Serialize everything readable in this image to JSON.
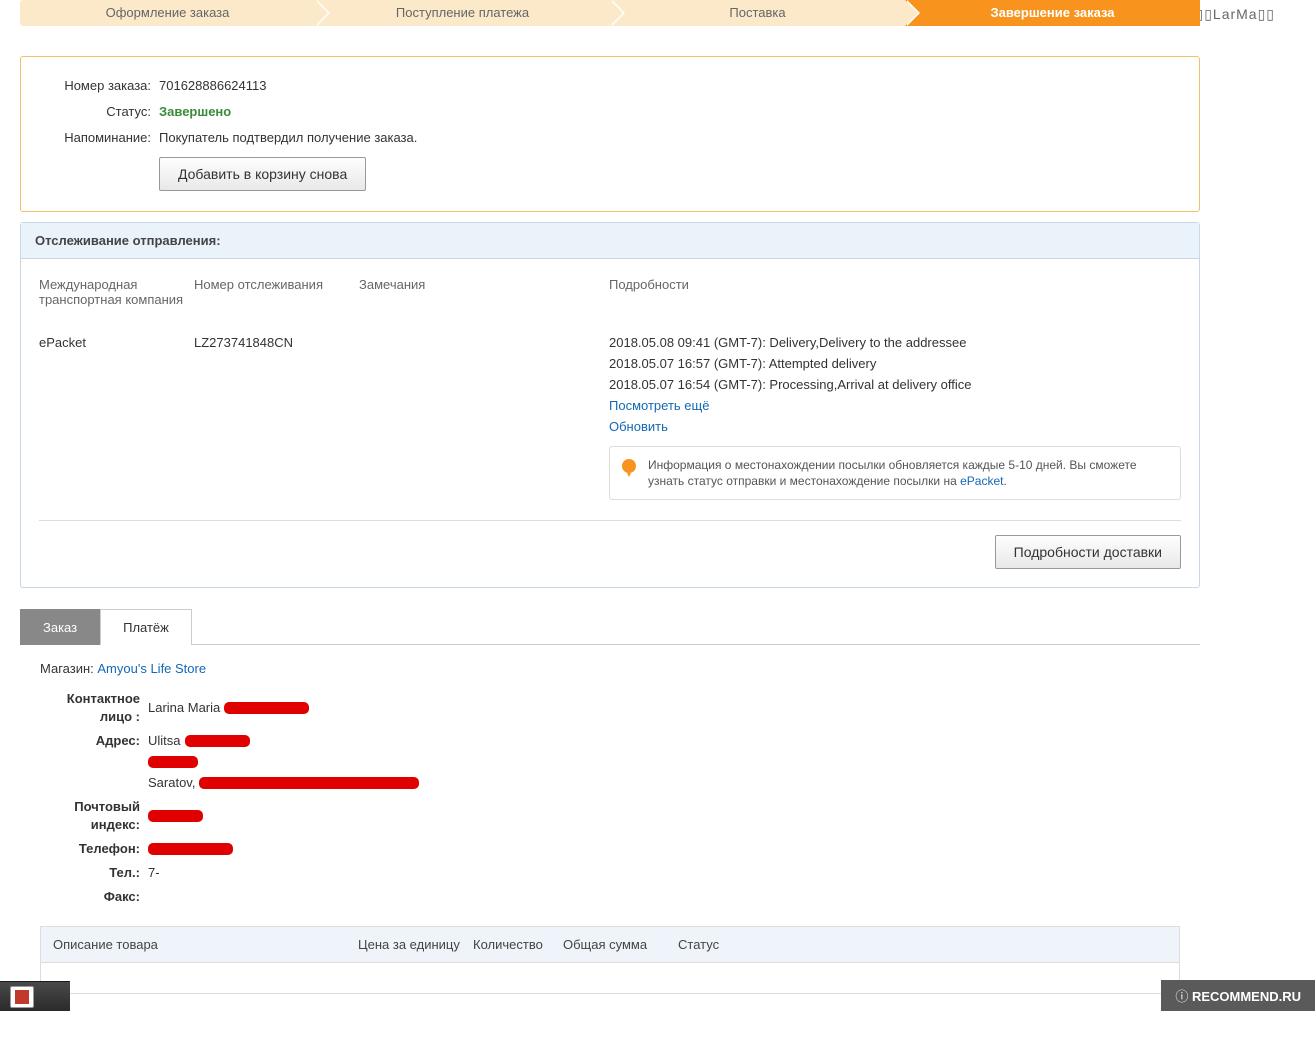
{
  "watermark_top": "▯▯LarMa▯▯",
  "watermark_bottom": "RECOMMEND.RU",
  "steps": [
    {
      "label": "Оформление заказа",
      "active": false
    },
    {
      "label": "Поступление платежа",
      "active": false
    },
    {
      "label": "Поставка",
      "active": false
    },
    {
      "label": "Завершение заказа",
      "active": true
    }
  ],
  "order": {
    "labels": {
      "number": "Номер заказа:",
      "status": "Статус:",
      "reminder": "Напоминание:"
    },
    "number": "701628886624113",
    "status": "Завершено",
    "reminder": "Покупатель подтвердил получение заказа.",
    "add_to_cart_btn": "Добавить в корзину снова"
  },
  "tracking": {
    "header": "Отслеживание отправления:",
    "columns": {
      "carrier": "Международная транспортная компания",
      "number": "Номер отслеживания",
      "remarks": "Замечания",
      "details": "Подробности"
    },
    "carrier": "ePacket",
    "tracking_number": "LZ273741848CN",
    "events": [
      "2018.05.08 09:41 (GMT-7): Delivery,Delivery to the addressee",
      "2018.05.07 16:57 (GMT-7): Attempted delivery",
      "2018.05.07 16:54 (GMT-7): Processing,Arrival at delivery office"
    ],
    "see_more": "Посмотреть ещё",
    "refresh": "Обновить",
    "tip_text": "Информация о местонахождении посылки обновляется каждые 5-10 дней. Вы сможете узнать статус отправки и местонахождение посылки на ",
    "tip_link": "ePacket",
    "details_btn": "Подробности доставки"
  },
  "tabs": [
    {
      "label": "Заказ",
      "active": true
    },
    {
      "label": "Платёж",
      "active": false
    }
  ],
  "store": {
    "label": "Магазин:",
    "name": "Amyou's Life Store"
  },
  "contact": {
    "labels": {
      "person": "Контактное лицо :",
      "address": "Адрес:",
      "postal": "Почтовый индекс:",
      "phone": "Телефон:",
      "tel": "Тел.:",
      "fax": "Факс:"
    },
    "person_prefix": "Larina Maria",
    "address_prefix": "Ulitsa",
    "city_prefix": "Saratov,",
    "tel_value": "7-"
  },
  "product_table": {
    "headers": {
      "desc": "Описание товара",
      "price": "Цена за единицу",
      "qty": "Количество",
      "total": "Общая сумма",
      "status": "Статус"
    }
  }
}
